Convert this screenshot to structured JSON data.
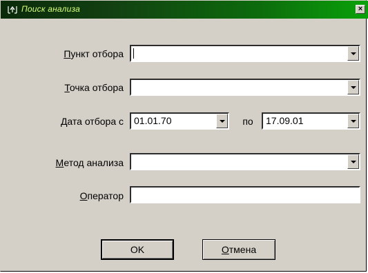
{
  "window": {
    "title": "Поиск анализа",
    "close": "×"
  },
  "fields": {
    "sampling_point": {
      "label_ul": "П",
      "label_rest": "ункт отбора",
      "value": ""
    },
    "sampling_spot": {
      "label_ul": "Т",
      "label_rest": "очка отбора",
      "value": ""
    },
    "date_from": {
      "label_ul": "Д",
      "label_rest": "ата отбора с",
      "value": "01.01.70"
    },
    "date_to_label": "по",
    "date_to": {
      "value": "17.09.01"
    },
    "method": {
      "label_ul": "М",
      "label_rest": "етод анализа",
      "value": ""
    },
    "operator": {
      "label_ul": "О",
      "label_rest": "ператор",
      "value": ""
    }
  },
  "buttons": {
    "ok": "OK",
    "cancel_ul": "О",
    "cancel_rest": "тмена"
  }
}
